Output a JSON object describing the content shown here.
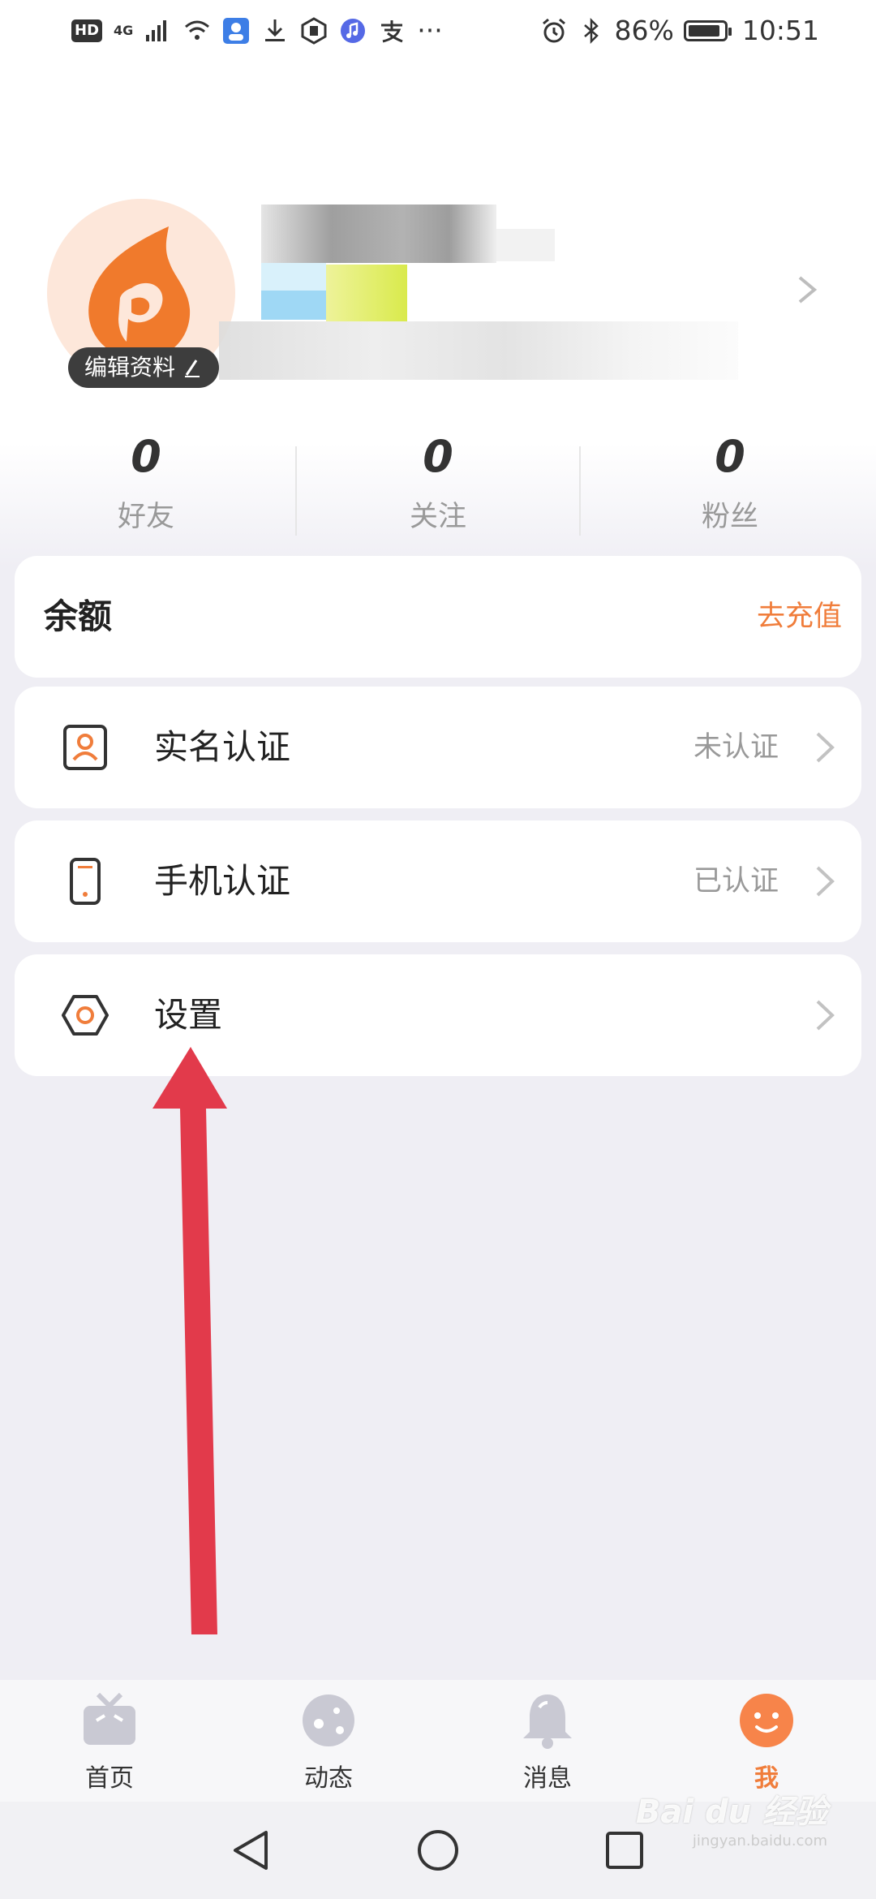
{
  "status_bar": {
    "hd": "HD",
    "network": "4G",
    "battery_percent": "86%",
    "time": "10:51",
    "more": "···"
  },
  "profile": {
    "edit_label": "编辑资料"
  },
  "stats": [
    {
      "value": "0",
      "label": "好友"
    },
    {
      "value": "0",
      "label": "关注"
    },
    {
      "value": "0",
      "label": "粉丝"
    }
  ],
  "balance": {
    "title": "余额",
    "action": "去充值"
  },
  "rows": [
    {
      "label": "实名认证",
      "value": "未认证",
      "icon": "id-card-icon"
    },
    {
      "label": "手机认证",
      "value": "已认证",
      "icon": "phone-icon"
    },
    {
      "label": "设置",
      "value": "",
      "icon": "settings-hexagon-icon"
    }
  ],
  "tabs": [
    {
      "label": "首页",
      "icon": "tv-icon",
      "active": false
    },
    {
      "label": "动态",
      "icon": "planet-icon",
      "active": false
    },
    {
      "label": "消息",
      "icon": "bell-icon",
      "active": false
    },
    {
      "label": "我",
      "icon": "smiley-icon",
      "active": true
    }
  ],
  "watermark": {
    "brand": "Bai du 经验",
    "url": "jingyan.baidu.com"
  },
  "colors": {
    "accent": "#f07d3b",
    "background": "#efeef4",
    "annotation_arrow": "#e23a4b"
  }
}
